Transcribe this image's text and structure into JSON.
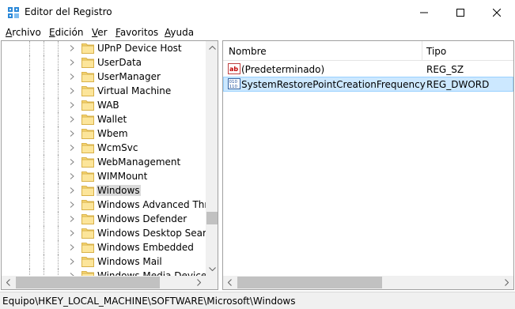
{
  "window": {
    "title": "Editor del Registro"
  },
  "menu": {
    "items": [
      {
        "label": "Archivo",
        "mnemonic": "A",
        "rest": "rchivo"
      },
      {
        "label": "Edición",
        "mnemonic": "E",
        "rest": "dición"
      },
      {
        "label": "Ver",
        "mnemonic": "V",
        "rest": "er"
      },
      {
        "label": "Favoritos",
        "mnemonic": "F",
        "rest": "avoritos"
      },
      {
        "label": "Ayuda",
        "mnemonic": "A",
        "rest": "yuda"
      }
    ]
  },
  "tree": {
    "items": [
      {
        "label": "UPnP Device Host"
      },
      {
        "label": "UserData"
      },
      {
        "label": "UserManager"
      },
      {
        "label": "Virtual Machine"
      },
      {
        "label": "WAB"
      },
      {
        "label": "Wallet"
      },
      {
        "label": "Wbem"
      },
      {
        "label": "WcmSvc"
      },
      {
        "label": "WebManagement"
      },
      {
        "label": "WIMMount"
      },
      {
        "label": "Windows",
        "selected": true
      },
      {
        "label": "Windows Advanced Threa"
      },
      {
        "label": "Windows Defender"
      },
      {
        "label": "Windows Desktop Search"
      },
      {
        "label": "Windows Embedded"
      },
      {
        "label": "Windows Mail"
      },
      {
        "label": "Windows Media Device M"
      }
    ]
  },
  "list": {
    "columns": {
      "name": "Nombre",
      "type": "Tipo"
    },
    "rows": [
      {
        "name": "(Predeterminado)",
        "type": "REG_SZ",
        "icon": "string-value-icon"
      },
      {
        "name": "SystemRestorePointCreationFrequency",
        "type": "REG_DWORD",
        "icon": "binary-value-icon",
        "selected": true
      }
    ]
  },
  "status": {
    "path": "Equipo\\HKEY_LOCAL_MACHINE\\SOFTWARE\\Microsoft\\Windows"
  },
  "colors": {
    "accent": "#0078d7",
    "selection": "#cce8ff",
    "folder": "#f8d775"
  }
}
